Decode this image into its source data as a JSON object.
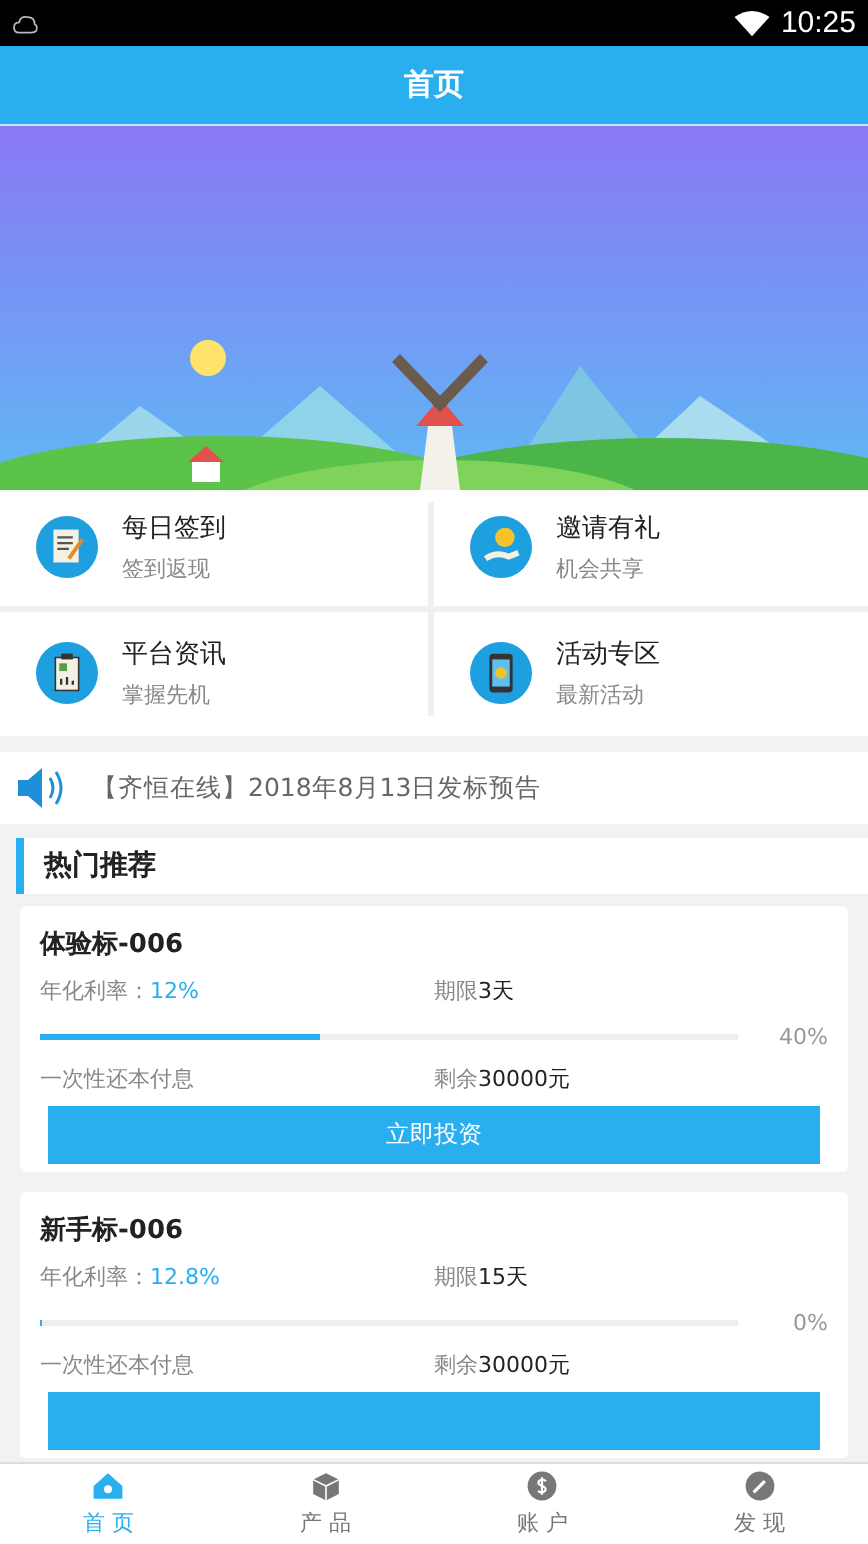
{
  "status_bar": {
    "time": "10:25"
  },
  "header": {
    "title": "首页"
  },
  "shortcuts": [
    {
      "title": "每日签到",
      "subtitle": "签到返现"
    },
    {
      "title": "邀请有礼",
      "subtitle": "机会共享"
    },
    {
      "title": "平台资讯",
      "subtitle": "掌握先机"
    },
    {
      "title": "活动专区",
      "subtitle": "最新活动"
    }
  ],
  "notice": {
    "text": "【齐恒在线】2018年8月13日发标预告"
  },
  "section": {
    "title": "热门推荐"
  },
  "products": [
    {
      "name": "体验标-006",
      "rate_label": "年化利率：",
      "rate": "12%",
      "term_label": "期限",
      "term": "3天",
      "level": 0.4,
      "percent": "40%",
      "repayment": "一次性还本付息",
      "remaining_label": "剩余",
      "remaining": "30000元",
      "button": "立即投资"
    },
    {
      "name": "新手标-006",
      "rate_label": "年化利率：",
      "rate": "12.8%",
      "term_label": "期限",
      "term": "15天",
      "level": 0,
      "percent": "0%",
      "repayment": "一次性还本付息",
      "remaining_label": "剩余",
      "remaining": "30000元"
    }
  ],
  "tabs": [
    {
      "label": "首 页",
      "selected": true
    },
    {
      "label": "产 品",
      "selected": false
    },
    {
      "label": "账 户",
      "selected": false
    },
    {
      "label": "发 现",
      "selected": false
    }
  ]
}
